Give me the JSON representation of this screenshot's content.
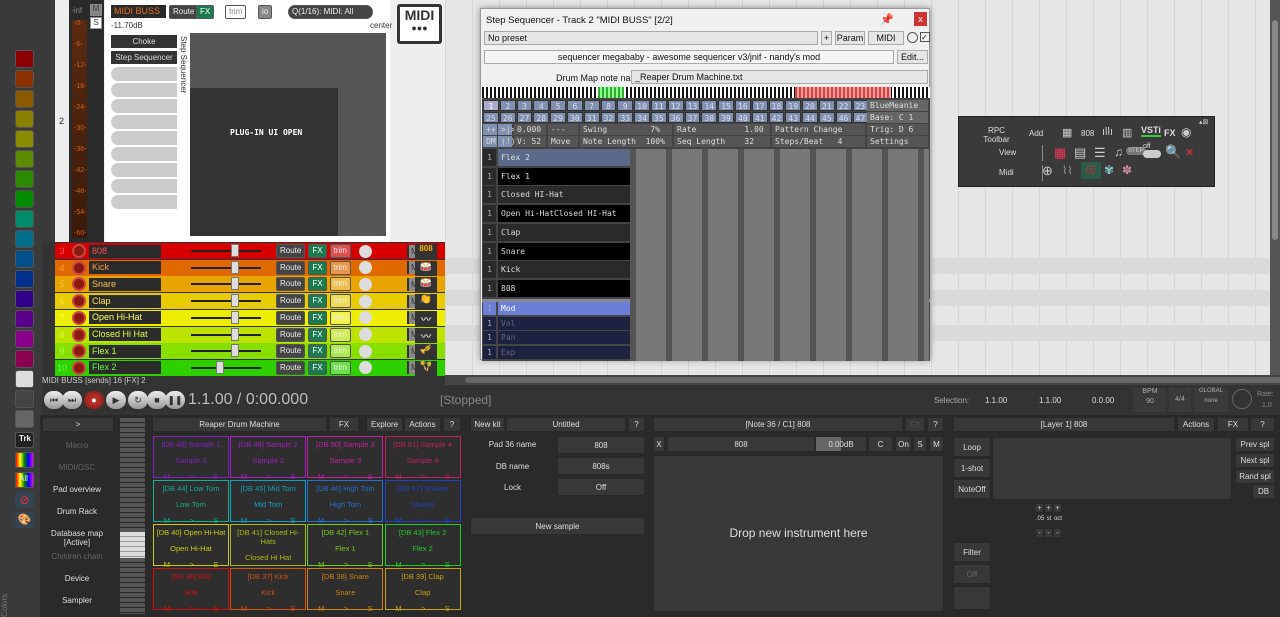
{
  "swatch_colors": [
    "#8b0000",
    "#8b3000",
    "#8b5a00",
    "#8b8000",
    "#8b8b00",
    "#5a8b00",
    "#2a8b00",
    "#008b00",
    "#008b6a",
    "#006e8b",
    "#00508b",
    "#00308b",
    "#30008b",
    "#5a008b",
    "#8b008b",
    "#8b0050",
    "#dddddd",
    "#444444",
    "#666666"
  ],
  "left_tools": {
    "trk": "Trk",
    "i": "I",
    "all": "All",
    "colors_label": "Colors"
  },
  "midi_buss": {
    "track_number": "2",
    "name": "MIDI BUSS",
    "route": "Route",
    "fx": "FX",
    "trim": "trim",
    "io": "io",
    "input": "Q(1/16): MIDI: All",
    "volume": "-11.70dB",
    "pan": "center",
    "mute": "M",
    "solo": "S",
    "meter_top": "-inf",
    "meter_ticks": [
      "-0-",
      "-6-",
      "-12-",
      "-18-",
      "-24-",
      "-30-",
      "-36-",
      "-42-",
      "-48-",
      "-54-",
      "-60-"
    ],
    "fx_chain": [
      "Choke",
      "Step Sequencer"
    ],
    "fx_chain_label": "Step Sequencer",
    "plugin_overlay": "PLUG-IN UI OPEN",
    "logo": "MIDI"
  },
  "tracks": [
    {
      "num": "3",
      "name": "808",
      "color": "#d60000",
      "text": "#ff5050"
    },
    {
      "num": "4",
      "name": "Kick",
      "color": "#e06a00",
      "text": "#ff9a40"
    },
    {
      "num": "5",
      "name": "Snare",
      "color": "#e8a400",
      "text": "#ffc040"
    },
    {
      "num": "6",
      "name": "Clap",
      "color": "#e8cc00",
      "text": "#ffe040"
    },
    {
      "num": "7",
      "name": "Open Hi-Hat",
      "color": "#eeee00",
      "text": "#ffff60"
    },
    {
      "num": "8",
      "name": "Closed Hi Hat",
      "color": "#bde400",
      "text": "#d8ff40"
    },
    {
      "num": "9",
      "name": "Flex 1",
      "color": "#88e000",
      "text": "#b0ff40"
    },
    {
      "num": "10",
      "name": "Flex 2",
      "color": "#2fd000",
      "text": "#60ff40"
    }
  ],
  "track_btns": {
    "route": "Route",
    "fx": "FX",
    "trim": "trim",
    "mute": "M",
    "solo": "S"
  },
  "mixer_status": "MIDI BUSS [sends] 16 [FX] 2",
  "step_seq": {
    "title": "Step Sequencer - Track 2 \"MIDI BUSS\" [2/2]",
    "close": "x",
    "preset": "No preset",
    "plus": "+",
    "param": "Param",
    "midi": "MIDI",
    "description": "sequencer megababy - awesome sequencer v3/jnif - nandy's mod",
    "edit": "Edit...",
    "drum_map_label": "Drum Map note names",
    "drum_map_value": "_Reaper Drum Machine.txt",
    "steps_row1": [
      "1",
      "2",
      "3",
      "4",
      "5",
      "6",
      "7",
      "8",
      "9",
      "10",
      "11",
      "12",
      "13",
      "14",
      "15",
      "16",
      "17",
      "18",
      "19",
      "20",
      "21",
      "22",
      "23",
      "24"
    ],
    "steps_row2": [
      "25",
      "26",
      "27",
      "28",
      "29",
      "30",
      "31",
      "32",
      "33",
      "34",
      "35",
      "36",
      "37",
      "38",
      "39",
      "40",
      "41",
      "42",
      "43",
      "44",
      "45",
      "46",
      "47",
      "48"
    ],
    "preset_name": "BlueMeanie",
    "base": "Base: C 1",
    "trig": "Trig: D 6",
    "settings": "Settings",
    "ctl_row1": [
      "++",
      ">|>",
      "0.000",
      "---",
      "Swing         7%",
      "Rate          1.00",
      "Pattern Change"
    ],
    "ctl_row2": [
      "DM",
      "(!)",
      "V: 52",
      "Move",
      "Note Length  100%",
      "Seq Length    32",
      "Steps/Beat   4"
    ],
    "rows": [
      {
        "ch": "1",
        "name": "Flex 2"
      },
      {
        "ch": "1",
        "name": "Flex 1"
      },
      {
        "ch": "1",
        "name": "Closed HI-Hat"
      },
      {
        "ch": "1",
        "name": "Open Hi-HatClosed HI-Hat"
      },
      {
        "ch": "1",
        "name": "Clap"
      },
      {
        "ch": "1",
        "name": "Snare"
      },
      {
        "ch": "1",
        "name": "Kick"
      },
      {
        "ch": "1",
        "name": "808"
      }
    ],
    "cc_rows": [
      {
        "ch": "1",
        "name": "Mod"
      },
      {
        "ch": "1",
        "name": "Vol"
      },
      {
        "ch": "1",
        "name": "Pan"
      },
      {
        "ch": "1",
        "name": "Exp"
      }
    ]
  },
  "rpc": {
    "title": "RPC Toolbar",
    "add": "Add",
    "view": "View",
    "midi": "Midi",
    "n808": "808",
    "vsti": "VSTi",
    "fx": "FX",
    "off": "off"
  },
  "transport": {
    "time": "1.1.00 / 0:00.000",
    "state": "[Stopped]",
    "selection_label": "Selection:",
    "sel_start": "1.1.00",
    "sel_end": "1.1.00",
    "sel_len": "0.0.00",
    "bpm_label": "BPM",
    "bpm": "90",
    "timesig": "4/4",
    "global": "GLOBAL",
    "none": "none",
    "rate_label": "Rate:",
    "rate": "1.0"
  },
  "rs5k": {
    "expand": ">",
    "nav": [
      {
        "label": "Macro",
        "dim": true
      },
      {
        "label": "MIDI/OSC",
        "dim": true
      },
      {
        "label": "Pad overview"
      },
      {
        "label": "Drum Rack"
      },
      {
        "label": "Database map [Active]"
      },
      {
        "label": "Children chain",
        "dim": true
      },
      {
        "label": "Device"
      },
      {
        "label": "Sampler"
      }
    ],
    "header": "Reaper Drum Machine",
    "fx": "FX",
    "explore": "Explore",
    "actions": "Actions",
    "help": "?",
    "pads": [
      {
        "top": "[DB 48] Sample 1",
        "name": "Sample 1",
        "color": "#8020c0"
      },
      {
        "top": "[DB 49] Sample 2",
        "name": "Sample 2",
        "color": "#a020c0"
      },
      {
        "top": "[DB 50] Sample 3",
        "name": "Sample 3",
        "color": "#c020a0"
      },
      {
        "top": "[DB 51] Sample 4",
        "name": "Sample 4",
        "color": "#c02060"
      },
      {
        "top": "[DB 44] Low Tom",
        "name": "Low Tom",
        "color": "#10b090"
      },
      {
        "top": "[DB 45] Mid Tom",
        "name": "Mid Tom",
        "color": "#10a0c0"
      },
      {
        "top": "[DB 46] High Tom",
        "name": "High Tom",
        "color": "#2070d0"
      },
      {
        "top": "[DB 47] Shaker",
        "name": "Shaker",
        "color": "#2040c0"
      },
      {
        "top": "[DB 40] Open Hi-Hat",
        "name": "Open Hi-Hat",
        "color": "#c8c810"
      },
      {
        "top": "[DB 41] Closed Hi-Hats",
        "name": "Closed Hi Hat",
        "color": "#a8b810"
      },
      {
        "top": "[DB 42] Flex 1",
        "name": "Flex 1",
        "color": "#70c820"
      },
      {
        "top": "[DB 43] Flex 2",
        "name": "Flex 2",
        "color": "#20c820"
      },
      {
        "top": "[DB 36] 808",
        "name": "808",
        "color": "#d01010"
      },
      {
        "top": "[DB 37] Kick",
        "name": "Kick",
        "color": "#d05010"
      },
      {
        "top": "[DB 38] Snare",
        "name": "Snare",
        "color": "#d08010"
      },
      {
        "top": "[DB 39] Clap",
        "name": "Clap",
        "color": "#c8a010"
      }
    ],
    "pad_m": "M",
    "pad_play": ">",
    "pad_s": "S",
    "kit": {
      "new_kit": "New kit",
      "name": "Untitled",
      "help": "?",
      "pad_name_label": "Pad 36 name",
      "pad_name": "808",
      "db_name_label": "DB name",
      "db_name": "808s",
      "lock_label": "Lock",
      "lock": "Off",
      "new_sample": "New sample"
    },
    "note": {
      "title": "[Note 36 / C1] 808",
      "fx": "FX",
      "help": "?",
      "x": "X",
      "name": "808",
      "gain": "0.00dB",
      "c": "C",
      "on": "On",
      "s": "S",
      "m": "M",
      "drop": "Drop new instrument here"
    },
    "layer": {
      "title": "[Layer 1] 808",
      "actions": "Actions",
      "fx": "FX",
      "help": "?",
      "loop": "Loop",
      "oneshot": "1-shot",
      "noteoff": "NoteOff",
      "prev": "Prev spl",
      "next": "Next spl",
      "rand": "Rand spl",
      "db": "DB",
      "plus": "+",
      "minus": "-",
      "fine": ".05",
      "st": "st",
      "oct": "oct",
      "filter": "Filter",
      "off": "Off"
    }
  }
}
